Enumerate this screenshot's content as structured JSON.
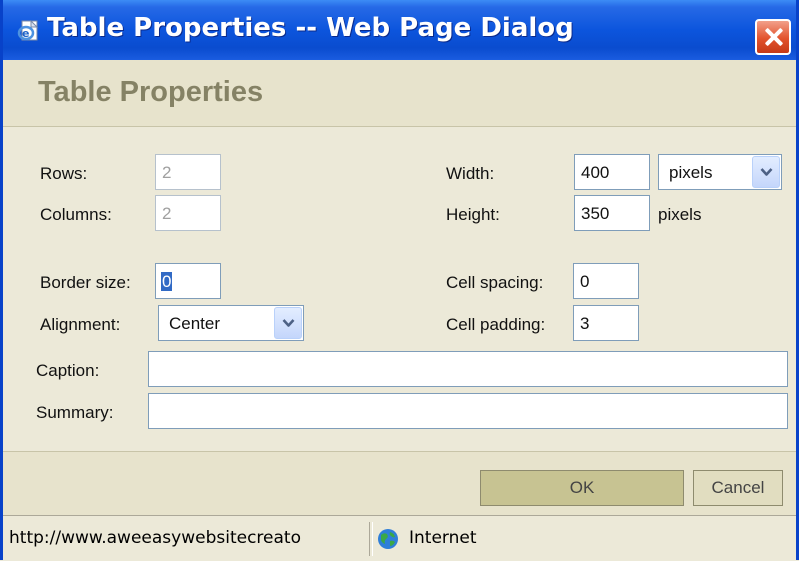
{
  "window": {
    "title": "Table Properties -- Web Page Dialog"
  },
  "header": {
    "title": "Table Properties"
  },
  "form": {
    "rows": {
      "label": "Rows:",
      "value": "2"
    },
    "columns": {
      "label": "Columns:",
      "value": "2"
    },
    "width": {
      "label": "Width:",
      "value": "400",
      "unit": "pixels"
    },
    "height": {
      "label": "Height:",
      "value": "350",
      "unit": "pixels"
    },
    "border_size": {
      "label": "Border size:",
      "value": "0"
    },
    "alignment": {
      "label": "Alignment:",
      "value": "Center"
    },
    "cell_spacing": {
      "label": "Cell spacing:",
      "value": "0"
    },
    "cell_padding": {
      "label": "Cell padding:",
      "value": "3"
    },
    "caption": {
      "label": "Caption:",
      "value": ""
    },
    "summary": {
      "label": "Summary:",
      "value": ""
    }
  },
  "buttons": {
    "ok": "OK",
    "cancel": "Cancel"
  },
  "statusbar": {
    "url": "http://www.aweeasywebsitecreato",
    "zone": "Internet"
  },
  "icons": {
    "title": "ie-page-icon",
    "close": "close-icon",
    "dropdown": "chevron-down-icon",
    "zone": "globe-icon"
  },
  "colors": {
    "titlebar": "#0A4CCF",
    "close": "#E2532D",
    "header_text": "#858265",
    "ok_button": "#C7C392",
    "selection": "#316AC5"
  }
}
